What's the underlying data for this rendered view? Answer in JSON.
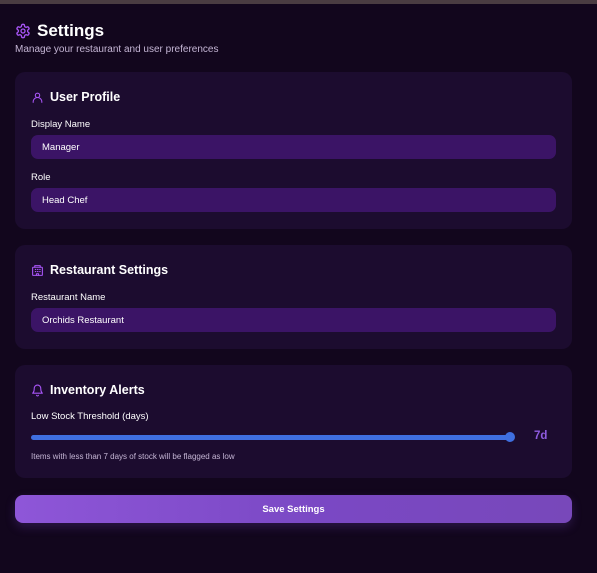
{
  "header": {
    "title": "Settings",
    "subtitle": "Manage your restaurant and user preferences",
    "icon": "gear-icon"
  },
  "user_profile": {
    "title": "User Profile",
    "icon": "user-icon",
    "display_name_label": "Display Name",
    "display_name_value": "Manager",
    "role_label": "Role",
    "role_value": "Head Chef"
  },
  "restaurant_settings": {
    "title": "Restaurant Settings",
    "icon": "building-icon",
    "name_label": "Restaurant Name",
    "name_value": "Orchids Restaurant"
  },
  "inventory_alerts": {
    "title": "Inventory Alerts",
    "icon": "bell-icon",
    "threshold_label": "Low Stock Threshold (days)",
    "threshold_value": 7,
    "threshold_min": 1,
    "threshold_max": 7,
    "threshold_display": "7d",
    "hint": "Items with less than 7 days of stock will be flagged as low"
  },
  "actions": {
    "save_label": "Save Settings"
  },
  "colors": {
    "background": "#12061d",
    "card": "#1c0c2f",
    "input": "#3b1466",
    "accent": "#a855f7",
    "slider": "#3f6fe0",
    "button_start": "#8e56d8",
    "button_end": "#7848ba"
  }
}
